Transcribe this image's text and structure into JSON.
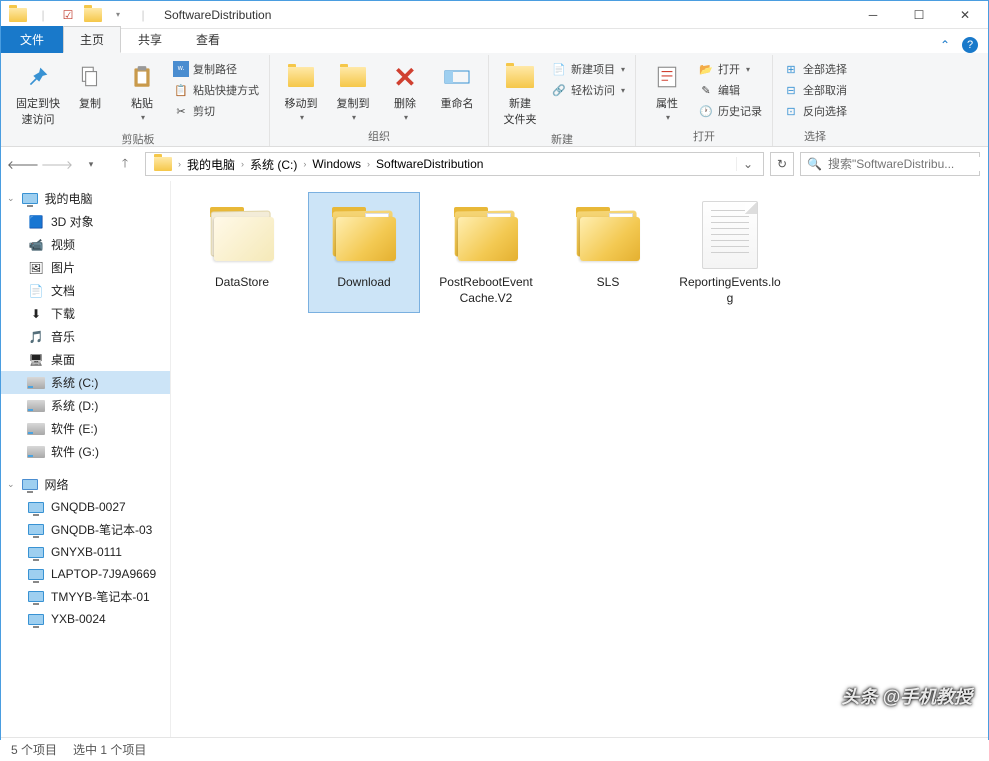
{
  "window": {
    "title": "SoftwareDistribution"
  },
  "tabs": {
    "file": "文件",
    "home": "主页",
    "share": "共享",
    "view": "查看"
  },
  "ribbon": {
    "pin": "固定到快\n速访问",
    "copy": "复制",
    "paste": "粘贴",
    "copy_path": "复制路径",
    "paste_shortcut": "粘贴快捷方式",
    "cut": "剪切",
    "clipboard": "剪贴板",
    "move_to": "移动到",
    "copy_to": "复制到",
    "delete": "删除",
    "rename": "重命名",
    "organize": "组织",
    "new_folder": "新建\n文件夹",
    "new_item": "新建项目",
    "easy_access": "轻松访问",
    "new": "新建",
    "properties": "属性",
    "open": "打开",
    "edit": "编辑",
    "history": "历史记录",
    "open_group": "打开",
    "select_all": "全部选择",
    "select_none": "全部取消",
    "invert_selection": "反向选择",
    "select": "选择"
  },
  "breadcrumb": [
    "我的电脑",
    "系统 (C:)",
    "Windows",
    "SoftwareDistribution"
  ],
  "search": {
    "placeholder": "搜索\"SoftwareDistribu..."
  },
  "nav": {
    "my_computer": "我的电脑",
    "items": [
      "3D 对象",
      "视频",
      "图片",
      "文档",
      "下载",
      "音乐",
      "桌面"
    ],
    "drives": [
      "系统 (C:)",
      "系统 (D:)",
      "软件 (E:)",
      "软件 (G:)"
    ],
    "network": "网络",
    "hosts": [
      "GNQDB-0027",
      "GNQDB-笔记本-03",
      "GNYXB-0111",
      "LAPTOP-7J9A9669",
      "TMYYB-笔记本-01",
      "YXB-0024"
    ]
  },
  "files": [
    {
      "name": "DataStore",
      "type": "folder-empty"
    },
    {
      "name": "Download",
      "type": "folder",
      "selected": true
    },
    {
      "name": "PostRebootEventCache.V2",
      "type": "folder"
    },
    {
      "name": "SLS",
      "type": "folder"
    },
    {
      "name": "ReportingEvents.log",
      "type": "text"
    }
  ],
  "status": {
    "count": "5 个项目",
    "selected": "选中 1 个项目"
  },
  "watermark": "头条 @手机教授"
}
